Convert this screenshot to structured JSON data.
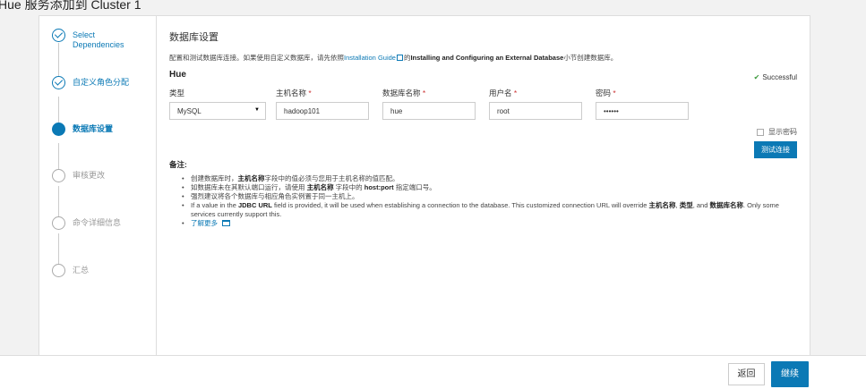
{
  "page_title": "Hue 服务添加到 Cluster 1",
  "steps": [
    {
      "label": "Select Dependencies",
      "state": "done"
    },
    {
      "label": "自定义角色分配",
      "state": "done"
    },
    {
      "label": "数据库设置",
      "state": "current"
    },
    {
      "label": "审核更改",
      "state": "pending"
    },
    {
      "label": "命令详细信息",
      "state": "pending"
    },
    {
      "label": "汇总",
      "state": "pending"
    }
  ],
  "section_title": "数据库设置",
  "description": {
    "before": "配置和测试数据库连接。如果使用自定义数据库，请先依照",
    "link": "Installation Guide",
    "middle": "的",
    "bold": "Installing and Configuring an External Database",
    "after": "小节创建数据库。"
  },
  "service_name": "Hue",
  "status": {
    "check": "✔",
    "text": "Successful"
  },
  "fields": {
    "type": {
      "label": "类型",
      "value": "MySQL"
    },
    "host": {
      "label": "主机名称",
      "value": "hadoop101"
    },
    "dbname": {
      "label": "数据库名称",
      "value": "hue"
    },
    "user": {
      "label": "用户名",
      "value": "root"
    },
    "password": {
      "label": "密码",
      "value": "••••••"
    }
  },
  "required_mark": "*",
  "show_password_label": "显示密码",
  "test_connection_label": "测试连接",
  "notes_title": "备注:",
  "notes": {
    "n1": {
      "a": "创建数据库时，",
      "b": "主机名称",
      "c": "字段中的值必须与您用于主机名称的值匹配。"
    },
    "n2": {
      "a": "如数据库未在其默认端口运行，请使用 ",
      "b": "主机名称",
      "c": " 字段中的 ",
      "d": "host:port",
      "e": " 指定端口号。"
    },
    "n3": {
      "a": "强烈建议将各个数据库与相应角色实例置于同一主机上。"
    },
    "n4": {
      "a": "If a value in the ",
      "b": "JDBC URL",
      "c": " field is provided, it will be used when establishing a connection to the database. This customized connection URL will override ",
      "d": "主机名称",
      "e": ", ",
      "f": "类型",
      "g": ", and ",
      "h": "数据库名称",
      "i": ". Only some services currently support this."
    },
    "learn_more": "了解更多"
  },
  "footer": {
    "back_label": "返回",
    "next_label": "继续"
  },
  "colors": {
    "accent": "#0b79b5",
    "success": "#3c9a3c",
    "required": "#cc3333"
  }
}
